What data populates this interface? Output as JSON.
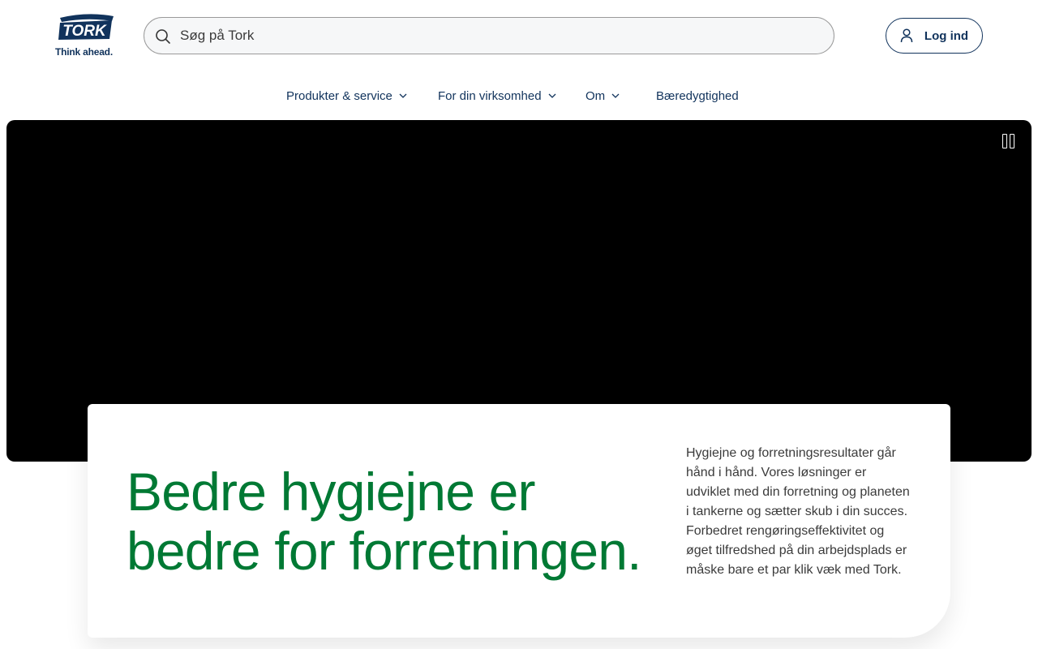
{
  "brand": {
    "logo_text": "TORK",
    "tagline": "Think ahead.",
    "primary_color": "#11335c",
    "accent_color": "#007934"
  },
  "search": {
    "placeholder": "Søg på Tork",
    "value": "",
    "icon": "search-icon"
  },
  "header": {
    "login_label": "Log ind",
    "login_icon": "user-icon"
  },
  "nav": {
    "items": [
      {
        "label": "Produkter & service",
        "has_dropdown": true
      },
      {
        "label": "For din virksomhed",
        "has_dropdown": true
      },
      {
        "label": "Om",
        "has_dropdown": true
      },
      {
        "label": "Bæredygtighed",
        "has_dropdown": false
      }
    ]
  },
  "hero": {
    "video_control": "pause-icon"
  },
  "card": {
    "headline": "Bedre hygiejne er bedre for forretningen.",
    "body": "Hygiejne og forretningsresultater går hånd i hånd. Vores løsninger er udviklet med din forretning og planeten i tankerne og sætter skub i din succes. Forbedret rengøringseffektivitet og øget tilfredshed på din arbejdsplads er måske bare et par klik væk med Tork."
  }
}
